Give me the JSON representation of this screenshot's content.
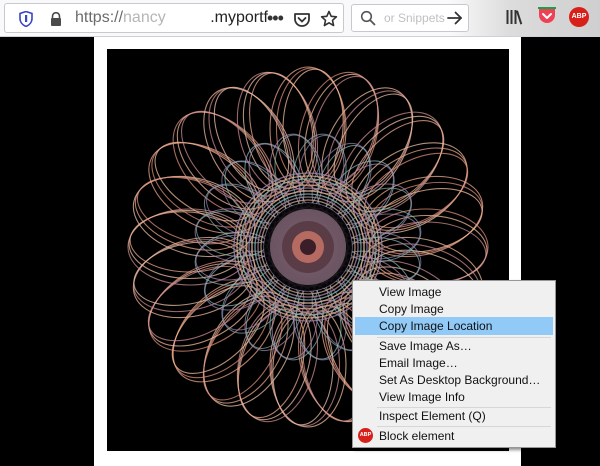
{
  "toolbar": {
    "url_scheme": "https://",
    "url_user": "nancy",
    "url_masked": "          ",
    "url_domain": ".myportf",
    "page_actions_glyph": "•••",
    "search_placeholder": "or Snippets",
    "abp_label": "ABP"
  },
  "context_menu": {
    "items": [
      {
        "label": "View Image",
        "access_key": "I"
      },
      {
        "label": "Copy Image",
        "access_key": "y"
      },
      {
        "label": "Copy Image Location",
        "access_key": "o",
        "highlighted": true
      },
      {
        "label": "Save Image As…",
        "access_key": "v"
      },
      {
        "label": "Email Image…",
        "access_key": "g"
      },
      {
        "label": "Set As Desktop Background…",
        "access_key": "S"
      },
      {
        "label": "View Image Info",
        "access_key": "f"
      },
      {
        "label": "Inspect Element (Q)",
        "access_key": "Q"
      },
      {
        "label": "Block element",
        "badge": "ABP"
      }
    ]
  },
  "colors": {
    "highlight": "#91c9f7",
    "abp_red": "#d8201b",
    "shield_blue": "#3a45c7"
  }
}
